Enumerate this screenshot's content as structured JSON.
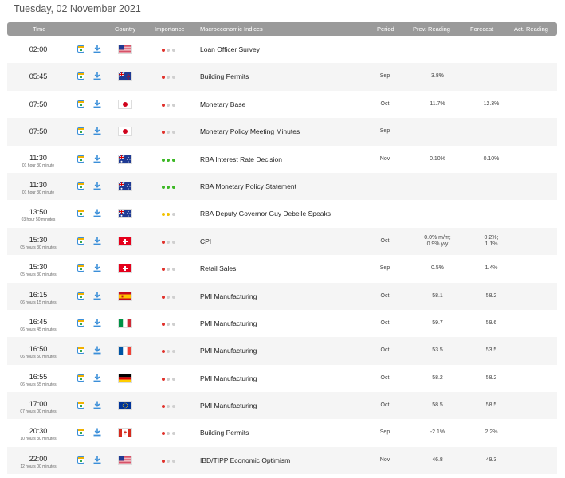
{
  "date_title": "Tuesday, 02 November 2021",
  "headers": {
    "time": "Time",
    "country": "Country",
    "importance": "Importance",
    "indices": "Macroeconomic Indices",
    "period": "Period",
    "prev": "Prev. Reading",
    "forecast": "Forecast",
    "act": "Act. Reading"
  },
  "colors": {
    "header_bg": "#9a9a9a",
    "importance_low": "#e0312b",
    "importance_high": "#3cb825",
    "importance_medium": "#f2c200",
    "importance_off": "#cfcfcf",
    "download": "#3b8fd9"
  },
  "rows": [
    {
      "time": "02:00",
      "sub": "",
      "flag": "us",
      "importance": "low",
      "event": "Loan Officer Survey",
      "period": "",
      "prev": "",
      "forecast": ""
    },
    {
      "time": "05:45",
      "sub": "",
      "flag": "nz",
      "importance": "low",
      "event": "Building Permits",
      "period": "Sep",
      "prev": "3.8%",
      "forecast": ""
    },
    {
      "time": "07:50",
      "sub": "",
      "flag": "jp",
      "importance": "low",
      "event": "Monetary Base",
      "period": "Oct",
      "prev": "11.7%",
      "forecast": "12.3%"
    },
    {
      "time": "07:50",
      "sub": "",
      "flag": "jp",
      "importance": "low",
      "event": "Monetary Policy Meeting Minutes",
      "period": "Sep",
      "prev": "",
      "forecast": ""
    },
    {
      "time": "11:30",
      "sub": "01 hour 30 minute",
      "flag": "au",
      "importance": "high",
      "event": "RBA Interest Rate Decision",
      "period": "Nov",
      "prev": "0.10%",
      "forecast": "0.10%"
    },
    {
      "time": "11:30",
      "sub": "01 hour 30 minute",
      "flag": "au",
      "importance": "high",
      "event": "RBA Monetary Policy Statement",
      "period": "",
      "prev": "",
      "forecast": ""
    },
    {
      "time": "13:50",
      "sub": "03 hour 50 minutes",
      "flag": "au",
      "importance": "medium",
      "event": "RBA Deputy Governor Guy Debelle Speaks",
      "period": "",
      "prev": "",
      "forecast": ""
    },
    {
      "time": "15:30",
      "sub": "05 hours 30 minutes",
      "flag": "ch",
      "importance": "low",
      "event": "CPI",
      "period": "Oct",
      "prev": "0.0% m/m;\n0.9% y/y",
      "forecast": "0.2%;\n1.1%"
    },
    {
      "time": "15:30",
      "sub": "05 hours 30 minutes",
      "flag": "ch",
      "importance": "low",
      "event": "Retail Sales",
      "period": "Sep",
      "prev": "0.5%",
      "forecast": "1.4%"
    },
    {
      "time": "16:15",
      "sub": "06 hours 15 minutes",
      "flag": "es",
      "importance": "low",
      "event": "PMI Manufacturing",
      "period": "Oct",
      "prev": "58.1",
      "forecast": "58.2"
    },
    {
      "time": "16:45",
      "sub": "06 hours 45 minutes",
      "flag": "it",
      "importance": "low",
      "event": "PMI Manufacturing",
      "period": "Oct",
      "prev": "59.7",
      "forecast": "59.6"
    },
    {
      "time": "16:50",
      "sub": "06 hours 50 minutes",
      "flag": "fr",
      "importance": "low",
      "event": "PMI Manufacturing",
      "period": "Oct",
      "prev": "53.5",
      "forecast": "53.5"
    },
    {
      "time": "16:55",
      "sub": "06 hours 55 minutes",
      "flag": "de",
      "importance": "low",
      "event": "PMI Manufacturing",
      "period": "Oct",
      "prev": "58.2",
      "forecast": "58.2"
    },
    {
      "time": "17:00",
      "sub": "07 hours 00 minutes",
      "flag": "eu",
      "importance": "low",
      "event": "PMI Manufacturing",
      "period": "Oct",
      "prev": "58.5",
      "forecast": "58.5"
    },
    {
      "time": "20:30",
      "sub": "10 hours 30 minutes",
      "flag": "ca",
      "importance": "low",
      "event": "Building Permits",
      "period": "Sep",
      "prev": "-2.1%",
      "forecast": "2.2%"
    },
    {
      "time": "22:00",
      "sub": "12 hours 00 minutes",
      "flag": "us",
      "importance": "low",
      "event": "IBD/TIPP Economic Optimism",
      "period": "Nov",
      "prev": "46.8",
      "forecast": "49.3"
    }
  ]
}
